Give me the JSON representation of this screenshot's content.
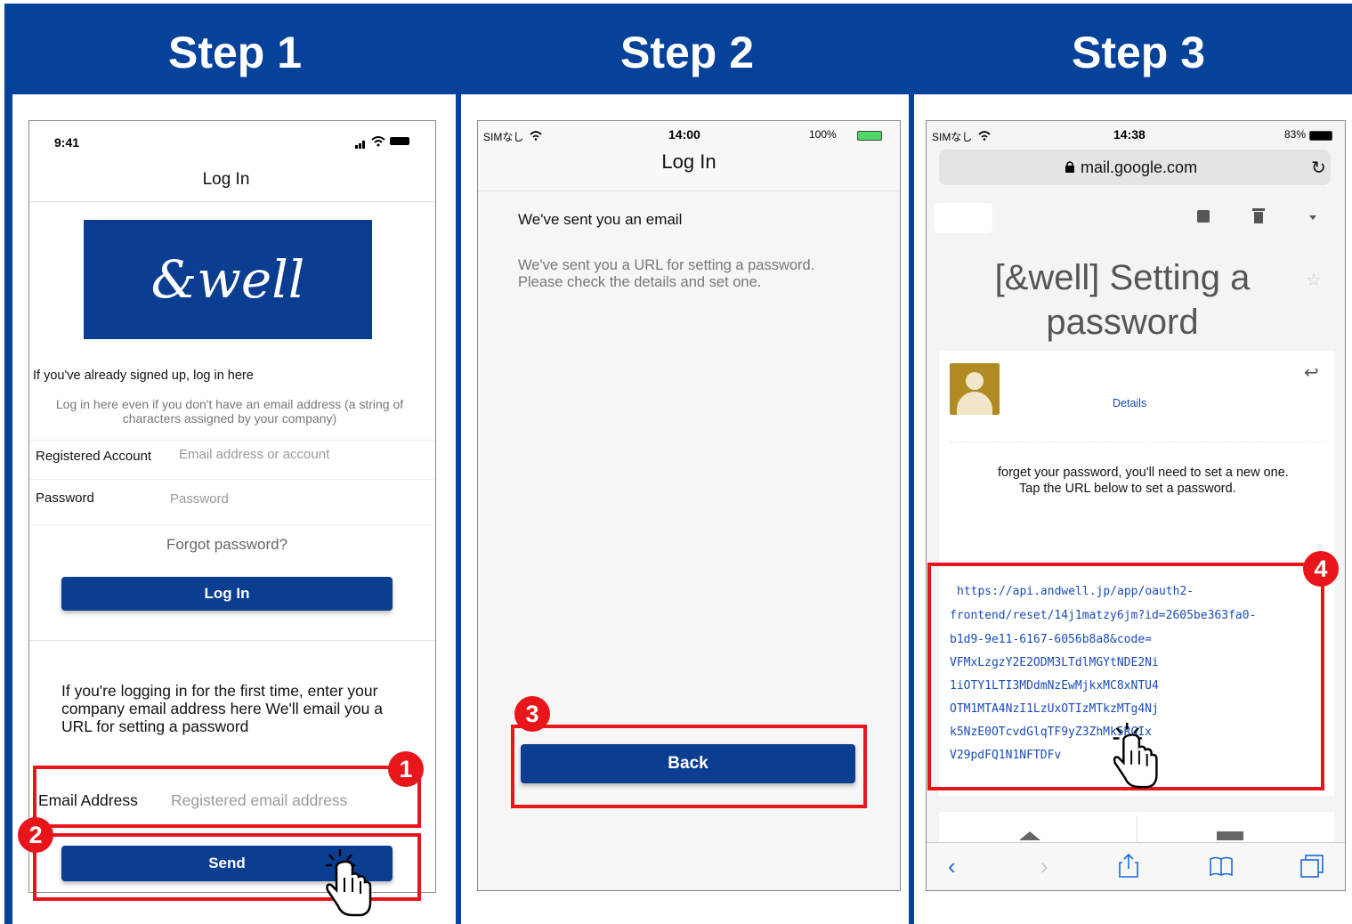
{
  "steps": [
    {
      "title": "Step 1"
    },
    {
      "title": "Step 2"
    },
    {
      "title": "Step 3"
    }
  ],
  "colors": {
    "header": "#06419a",
    "accent_red": "#e8161b",
    "button_navy": "#0b3d91",
    "link_blue": "#1a4bb5"
  },
  "phone1": {
    "time": "9:41",
    "nav_title": "Log In",
    "logo_text": "&well",
    "signed_up_heading": "If you've already signed up, log in here",
    "signed_up_note": "Log in here even if you don't have an email address (a string of characters assigned by your company)",
    "account_label": "Registered Account",
    "account_placeholder": "Email address or account",
    "password_label": "Password",
    "password_placeholder": "Password",
    "forgot_label": "Forgot password?",
    "login_button": "Log In",
    "first_time_text": "If you're logging in for the first time, enter your company email address here We'll email you a URL for setting a password",
    "email_label": "Email Address",
    "email_placeholder": "Registered email address",
    "send_button": "Send",
    "badge1": "1",
    "badge2": "2"
  },
  "phone2": {
    "carrier": "SIMなし",
    "time": "14:00",
    "battery": "100%",
    "nav_title": "Log In",
    "heading": "We've sent you an email",
    "message": "We've sent you a URL for setting a password. Please check the details and set one.",
    "back_button": "Back",
    "badge3": "3"
  },
  "phone3": {
    "carrier": "SIMなし",
    "time": "14:38",
    "battery": "83%",
    "url_host": "mail.google.com",
    "subject": "[&well] Setting a password",
    "details_link": "Details",
    "body_line1": "forget your password, you'll need to set a new one.",
    "body_line2": "Tap the URL below to set a password.",
    "reset_link_lines": [
      "https://api.andwell.jp/app/oauth2-",
      "frontend/reset/14j1matzy6jm?id=2605be363fa0-",
      "b1d9-9e11-6167-6056b8a8&code=",
      "VFMxLzgzY2E2ODM3LTdlMGYtNDE2Ni",
      "1iOTY1LTI3MDdmNzEwMjkxMC8xNTU4",
      "OTM1MTA4NzI1LzUxOTIzMTkzMTg4Nj",
      "k5NzE0OTcvdGlqTF9yZ3ZhMk5RGIx",
      "V29pdFQ1N1NFTDFv"
    ],
    "badge4": "4"
  },
  "icons": [
    "signal-icon",
    "wifi-icon",
    "battery-icon",
    "lock-icon",
    "reload-icon",
    "archive-icon",
    "trash-icon",
    "dropdown-icon",
    "star-icon",
    "reply-icon",
    "avatar-icon",
    "back-arrow-icon",
    "forward-arrow-icon",
    "share-icon",
    "bookmarks-icon",
    "tabs-icon",
    "pointer-hand-icon"
  ]
}
